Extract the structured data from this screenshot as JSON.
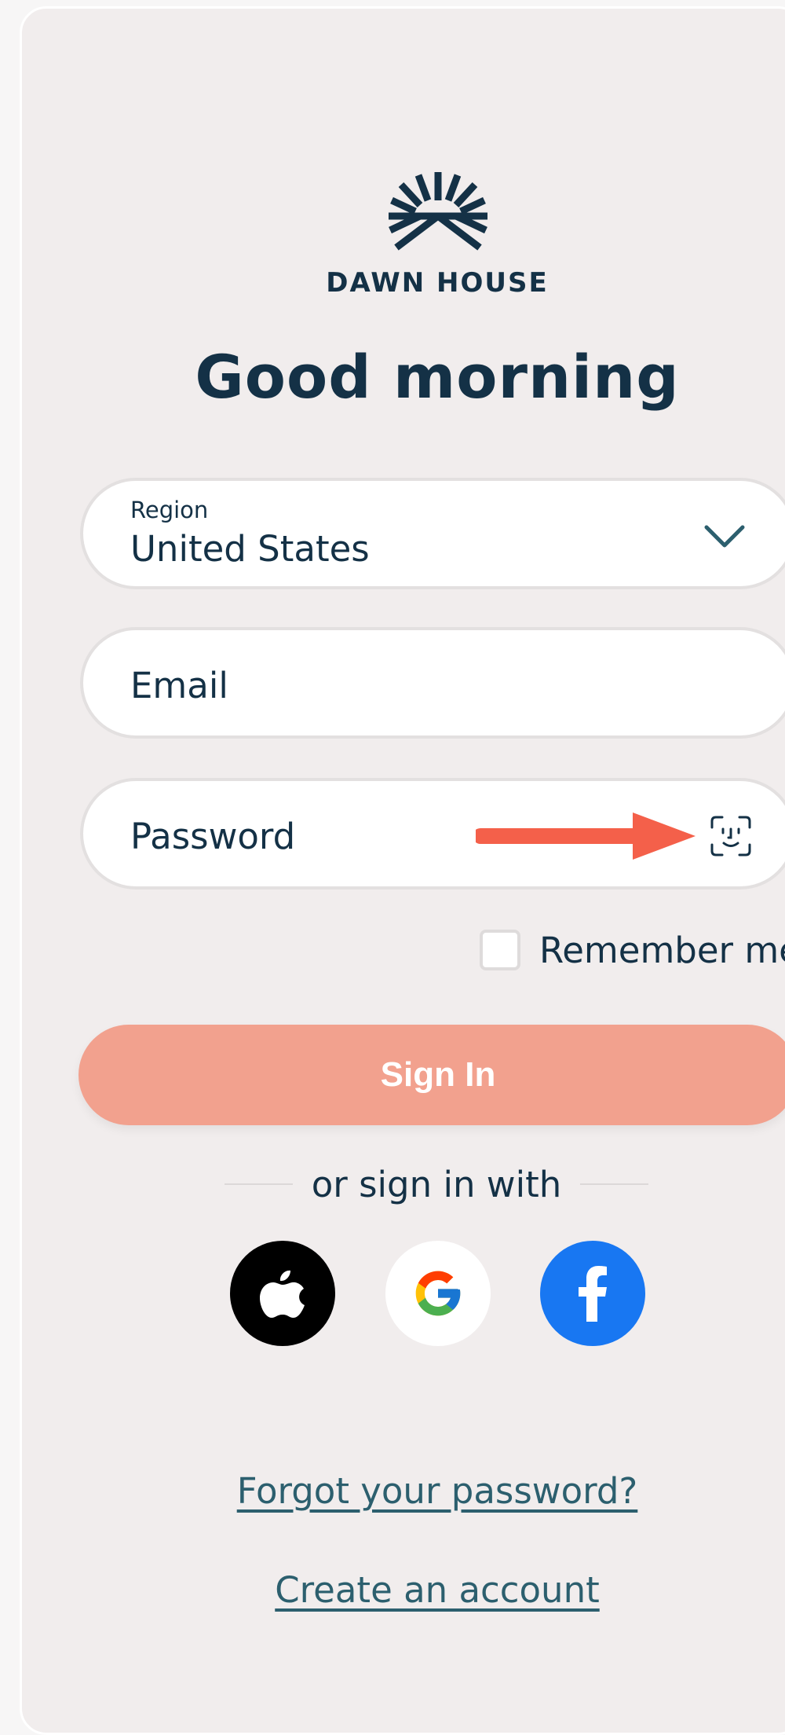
{
  "brand": {
    "name": "DAWN HOUSE"
  },
  "greeting": "Good morning",
  "region": {
    "label": "Region",
    "value": "United States"
  },
  "email": {
    "placeholder": "Email"
  },
  "password": {
    "placeholder": "Password"
  },
  "remember": {
    "label": "Remember me",
    "checked": false
  },
  "signin": {
    "label": "Sign In"
  },
  "divider": {
    "text": "or sign in with"
  },
  "social": [
    "apple-icon",
    "google-icon",
    "facebook-icon"
  ],
  "links": {
    "forgot": "Forgot your password?",
    "create": "Create an account"
  },
  "colors": {
    "background": "#f1eded",
    "primary_text": "#143146",
    "signin_button": "#f2a18e",
    "arrow": "#f4604a",
    "link": "#2c5f6e",
    "facebook": "#1877f2"
  }
}
